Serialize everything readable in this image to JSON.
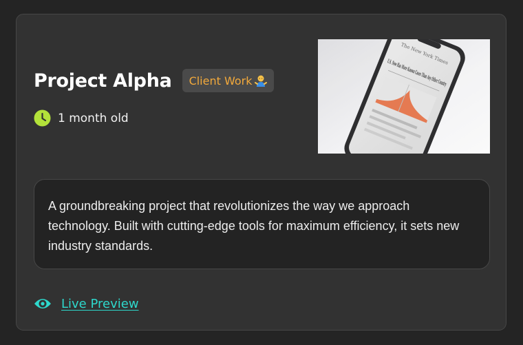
{
  "project": {
    "title": "Project Alpha",
    "badge_label": "Client Work",
    "badge_emoji_icon": "person-shrugging-icon",
    "age": "1 month old",
    "description": "A groundbreaking project that revolutionizes the way we approach technology. Built with cutting-edge tools for maximum efficiency, it sets new industry standards.",
    "image_icon": "phone-photo",
    "preview_label": "Live Preview",
    "photo_text": {
      "masthead": "The New York Times",
      "headline": "U.S. Now Has More Known Cases Than Any Other Country"
    }
  },
  "colors": {
    "background": "#242424",
    "card": "#323232",
    "badge_text": "#f2a93b",
    "clock": "#b3e23a",
    "link": "#2ed8cc"
  }
}
